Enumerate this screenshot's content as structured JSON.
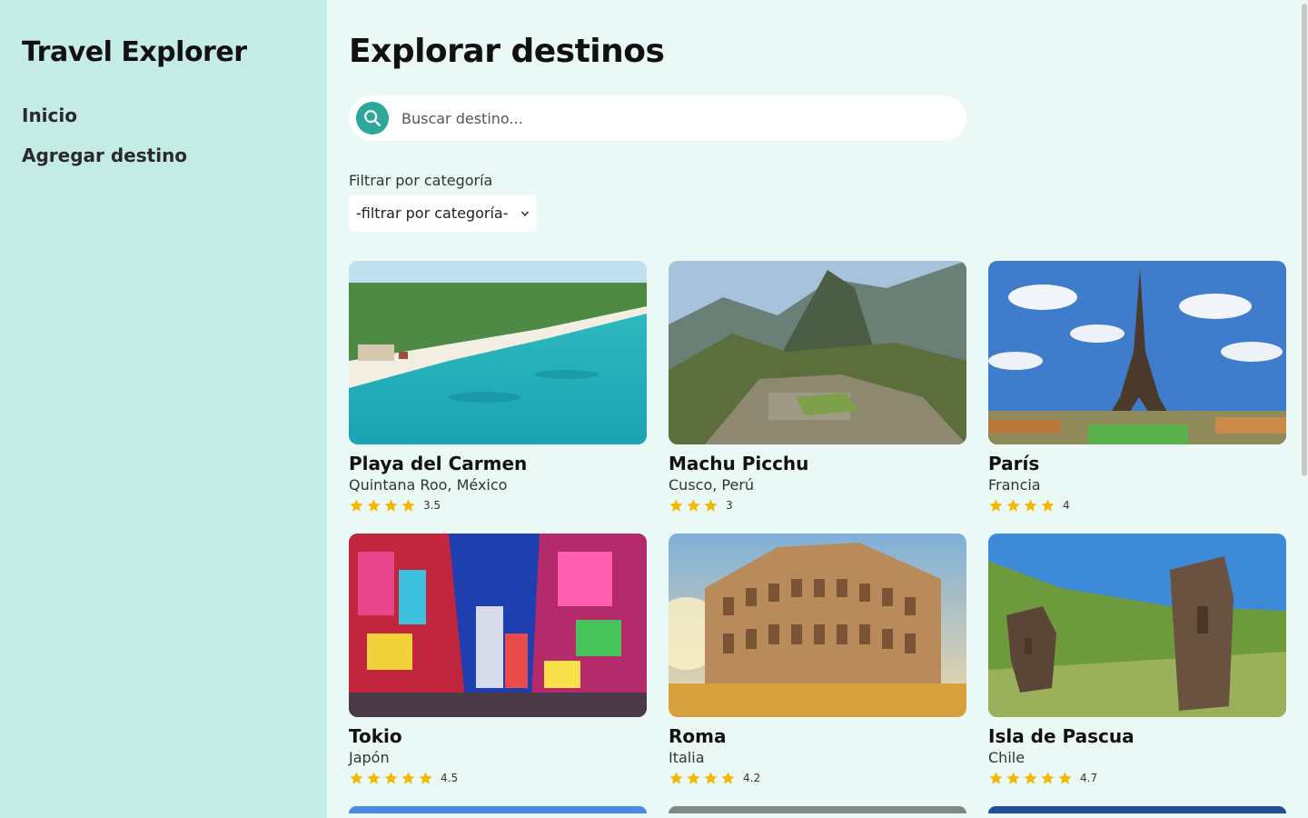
{
  "sidebar": {
    "title": "Travel Explorer",
    "items": [
      {
        "label": "Inicio"
      },
      {
        "label": "Agregar destino"
      }
    ]
  },
  "main": {
    "title": "Explorar destinos",
    "search": {
      "placeholder": "Buscar destino...",
      "icon": "search-icon"
    },
    "filter": {
      "label": "Filtrar por categoría",
      "selected": "-filtrar por categoría-"
    },
    "accent_color": "#2ba89a",
    "star_color": "#f5b800",
    "destinations": [
      {
        "name": "Playa del Carmen",
        "location": "Quintana Roo, México",
        "rating": 3.5,
        "stars_shown": 4,
        "rating_label": "3.5"
      },
      {
        "name": "Machu Picchu",
        "location": "Cusco, Perú",
        "rating": 3,
        "stars_shown": 3,
        "rating_label": "3"
      },
      {
        "name": "París",
        "location": "Francia",
        "rating": 4,
        "stars_shown": 4,
        "rating_label": "4"
      },
      {
        "name": "Tokio",
        "location": "Japón",
        "rating": 4.5,
        "stars_shown": 5,
        "rating_label": "4.5"
      },
      {
        "name": "Roma",
        "location": "Italia",
        "rating": 4.2,
        "stars_shown": 4,
        "rating_label": "4.2"
      },
      {
        "name": "Isla de Pascua",
        "location": "Chile",
        "rating": 4.7,
        "stars_shown": 5,
        "rating_label": "4.7"
      }
    ]
  }
}
